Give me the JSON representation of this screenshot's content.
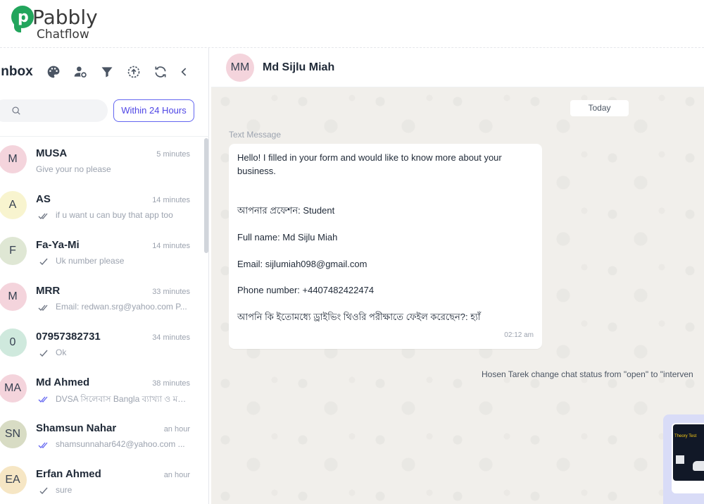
{
  "brand": {
    "name": "Pabbly",
    "product": "Chatflow",
    "accent": "#22a55c"
  },
  "inbox": {
    "title": "Inbox",
    "icons": [
      "palette-icon",
      "user-settings-icon",
      "filter-icon",
      "upload-icon",
      "refresh-icon",
      "chevron-left-icon"
    ],
    "search": {
      "placeholder": "",
      "value": ""
    },
    "filter_label": "Within 24 Hours"
  },
  "chats": [
    {
      "initials": "M",
      "name": "MUSA",
      "time": "5 minutes",
      "preview": "Give your no please",
      "tick": "none",
      "avatar_color": "#f4d4dc"
    },
    {
      "initials": "A",
      "name": "AS",
      "time": "14 minutes",
      "preview": "if u want u can buy that app too",
      "tick": "double",
      "avatar_color": "#f8f4cf"
    },
    {
      "initials": "F",
      "name": "Fa-Ya-Mi",
      "time": "14 minutes",
      "preview": "Uk number please",
      "tick": "single",
      "avatar_color": "#dfe7d4"
    },
    {
      "initials": "M",
      "name": "MRR",
      "time": "33 minutes",
      "preview": "Email: redwan.srg@yahoo.com P...",
      "tick": "double",
      "avatar_color": "#f4d4dc"
    },
    {
      "initials": "0",
      "name": "07957382731",
      "time": "34 minutes",
      "preview": "Ok",
      "tick": "single",
      "avatar_color": "#cfe9dd"
    },
    {
      "initials": "MA",
      "name": "Md Ahmed",
      "time": "38 minutes",
      "preview": "DVSA সিলেবাস Bangla ব্যাখ্যা ও মডে...",
      "tick": "double-blue",
      "avatar_color": "#f4d4dc"
    },
    {
      "initials": "SN",
      "name": "Shamsun Nahar",
      "time": "an hour",
      "preview": "shamsunnahar642@yahoo.com ...",
      "tick": "double-blue",
      "avatar_color": "#d8dcc4"
    },
    {
      "initials": "EA",
      "name": "Erfan Ahmed",
      "time": "an hour",
      "preview": "sure",
      "tick": "single",
      "avatar_color": "#f6e6c4"
    }
  ],
  "conversation": {
    "contact_initials": "MM",
    "contact_name": "Md Sijlu Miah",
    "date_label": "Today",
    "message_type": "Text Message",
    "message_lines": [
      "Hello! I filled in your form and would like to know more about your business.",
      "আপনার প্রফেশন: Student",
      "Full name: Md Sijlu Miah",
      "Email: sijlumiah098@gmail.com",
      "Phone number: +4407482422474",
      "আপনি কি ইতোমধ্যে ড্রাইভিং থিওরি পরীক্ষাতে ফেইল করেছেন?: হ্যাঁ"
    ],
    "message_time": "02:12 am",
    "status_note": "Hosen Tarek change chat status from \"open\" to \"interven",
    "media_caption": "Theory Test"
  }
}
